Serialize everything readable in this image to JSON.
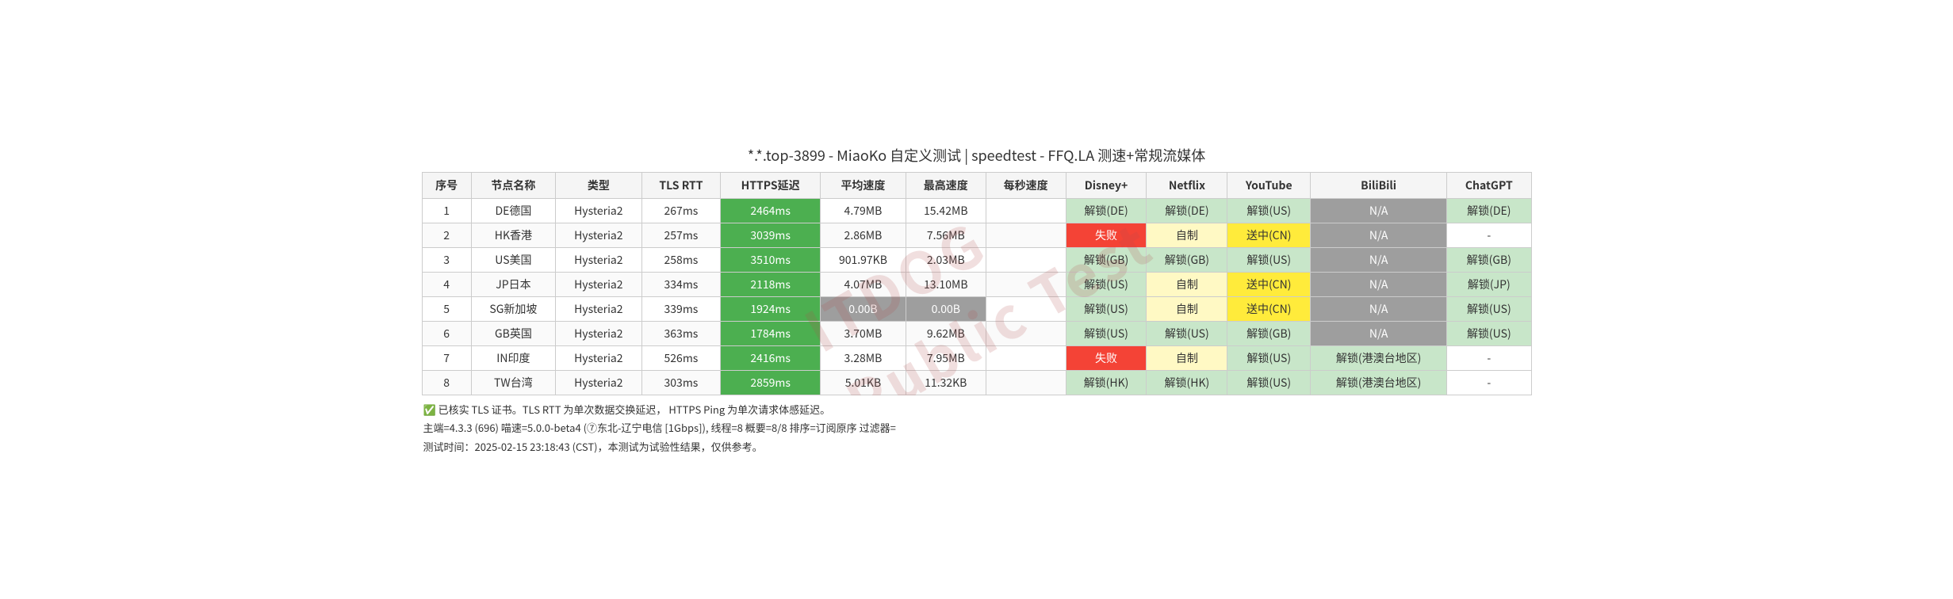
{
  "title": "*.*.top-3899 - MiaoKo 自定义测试 | speedtest - FFQ.LA 测速+常规流媒体",
  "watermark": "ITDOG\nPublic Test",
  "headers": [
    "序号",
    "节点名称",
    "类型",
    "TLS RTT",
    "HTTPS延迟",
    "平均速度",
    "最高速度",
    "每秒速度",
    "Disney+",
    "Netflix",
    "YouTube",
    "BiliBili",
    "ChatGPT"
  ],
  "rows": [
    {
      "id": "1",
      "name": "DE德国",
      "type": "Hysteria2",
      "tls_rtt": "267ms",
      "https": "2464ms",
      "avg_speed": "4.79MB",
      "max_speed": "15.42MB",
      "per_sec": "",
      "disney": "解锁(DE)",
      "netflix": "解锁(DE)",
      "youtube": "解锁(US)",
      "bilibili": "N/A",
      "chatgpt": "解锁(DE)",
      "https_class": "cell-green-dark",
      "disney_class": "cell-light-green",
      "netflix_class": "cell-light-green",
      "youtube_class": "cell-light-green",
      "bilibili_class": "cell-na",
      "chatgpt_class": "cell-light-green"
    },
    {
      "id": "2",
      "name": "HK香港",
      "type": "Hysteria2",
      "tls_rtt": "257ms",
      "https": "3039ms",
      "avg_speed": "2.86MB",
      "max_speed": "7.56MB",
      "per_sec": "",
      "disney": "失败",
      "netflix": "自制",
      "youtube": "送中(CN)",
      "bilibili": "N/A",
      "chatgpt": "-",
      "https_class": "cell-green-dark",
      "disney_class": "cell-red",
      "netflix_class": "cell-light-yellow",
      "youtube_class": "cell-yellow",
      "bilibili_class": "cell-na",
      "chatgpt_class": "cell-dash"
    },
    {
      "id": "3",
      "name": "US美国",
      "type": "Hysteria2",
      "tls_rtt": "258ms",
      "https": "3510ms",
      "avg_speed": "901.97KB",
      "max_speed": "2.03MB",
      "per_sec": "",
      "disney": "解锁(GB)",
      "netflix": "解锁(GB)",
      "youtube": "解锁(US)",
      "bilibili": "N/A",
      "chatgpt": "解锁(GB)",
      "https_class": "cell-green-dark",
      "disney_class": "cell-light-green",
      "netflix_class": "cell-light-green",
      "youtube_class": "cell-light-green",
      "bilibili_class": "cell-na",
      "chatgpt_class": "cell-light-green"
    },
    {
      "id": "4",
      "name": "JP日本",
      "type": "Hysteria2",
      "tls_rtt": "334ms",
      "https": "2118ms",
      "avg_speed": "4.07MB",
      "max_speed": "13.10MB",
      "per_sec": "",
      "disney": "解锁(US)",
      "netflix": "自制",
      "youtube": "送中(CN)",
      "bilibili": "N/A",
      "chatgpt": "解锁(JP)",
      "https_class": "cell-green-dark",
      "disney_class": "cell-light-green",
      "netflix_class": "cell-light-yellow",
      "youtube_class": "cell-yellow",
      "bilibili_class": "cell-na",
      "chatgpt_class": "cell-light-green"
    },
    {
      "id": "5",
      "name": "SG新加坡",
      "type": "Hysteria2",
      "tls_rtt": "339ms",
      "https": "1924ms",
      "avg_speed": "0.00B",
      "max_speed": "0.00B",
      "per_sec": "",
      "disney": "解锁(US)",
      "netflix": "自制",
      "youtube": "送中(CN)",
      "bilibili": "N/A",
      "chatgpt": "解锁(US)",
      "https_class": "cell-green-dark",
      "disney_class": "cell-light-green",
      "netflix_class": "cell-light-yellow",
      "youtube_class": "cell-yellow",
      "bilibili_class": "cell-na",
      "chatgpt_class": "cell-light-green"
    },
    {
      "id": "6",
      "name": "GB英国",
      "type": "Hysteria2",
      "tls_rtt": "363ms",
      "https": "1784ms",
      "avg_speed": "3.70MB",
      "max_speed": "9.62MB",
      "per_sec": "",
      "disney": "解锁(US)",
      "netflix": "解锁(US)",
      "youtube": "解锁(GB)",
      "bilibili": "N/A",
      "chatgpt": "解锁(US)",
      "https_class": "cell-green-dark",
      "disney_class": "cell-light-green",
      "netflix_class": "cell-light-green",
      "youtube_class": "cell-light-green",
      "bilibili_class": "cell-na",
      "chatgpt_class": "cell-light-green"
    },
    {
      "id": "7",
      "name": "IN印度",
      "type": "Hysteria2",
      "tls_rtt": "526ms",
      "https": "2416ms",
      "avg_speed": "3.28MB",
      "max_speed": "7.95MB",
      "per_sec": "",
      "disney": "失败",
      "netflix": "自制",
      "youtube": "解锁(US)",
      "bilibili": "解锁(港澳台地区)",
      "chatgpt": "-",
      "https_class": "cell-green-dark",
      "disney_class": "cell-red",
      "netflix_class": "cell-light-yellow",
      "youtube_class": "cell-light-green",
      "bilibili_class": "cell-light-green",
      "chatgpt_class": "cell-dash"
    },
    {
      "id": "8",
      "name": "TW台湾",
      "type": "Hysteria2",
      "tls_rtt": "303ms",
      "https": "2859ms",
      "avg_speed": "5.01KB",
      "max_speed": "11.32KB",
      "per_sec": "",
      "disney": "解锁(HK)",
      "netflix": "解锁(HK)",
      "youtube": "解锁(US)",
      "bilibili": "解锁(港澳台地区)",
      "chatgpt": "-",
      "https_class": "cell-green-dark",
      "disney_class": "cell-light-green",
      "netflix_class": "cell-light-green",
      "youtube_class": "cell-light-green",
      "bilibili_class": "cell-light-green",
      "chatgpt_class": "cell-dash"
    }
  ],
  "footer": [
    "✅ 已核实 TLS 证书。TLS RTT 为单次数据交换延迟，  HTTPS Ping 为单次请求体感延迟。",
    "主端=4.3.3 (696) 喵速=5.0.0-beta4 (⑦东北-辽宁电信 [1Gbps]), 线程=8 概要=8/8 排序=订阅原序 过滤器=",
    "测试时间：2025-02-15 23:18:43 (CST)，本测试为试验性结果，仅供参考。"
  ]
}
